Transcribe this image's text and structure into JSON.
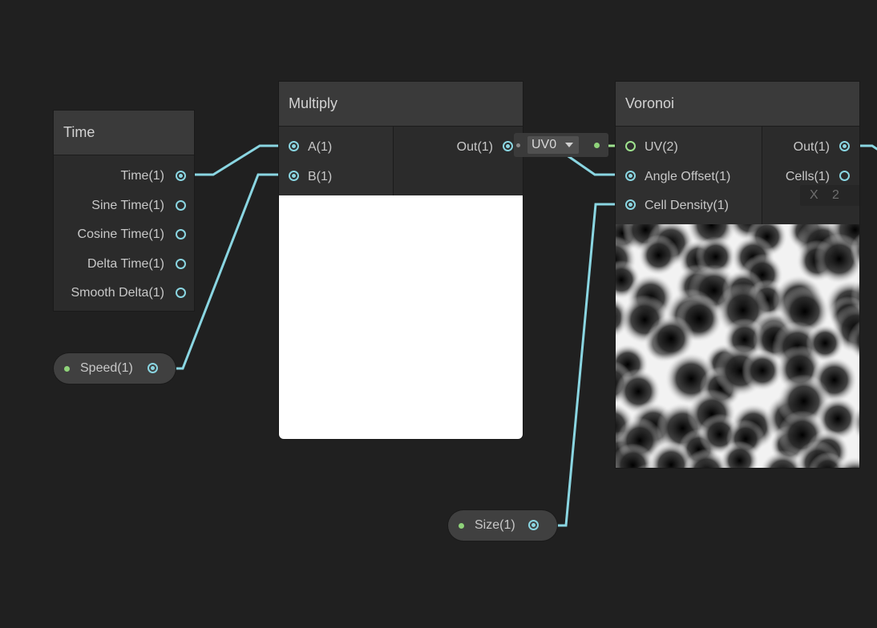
{
  "nodes": {
    "time": {
      "title": "Time",
      "outputs": [
        "Time(1)",
        "Sine Time(1)",
        "Cosine Time(1)",
        "Delta Time(1)",
        "Smooth Delta(1)"
      ]
    },
    "multiply": {
      "title": "Multiply",
      "inputs": [
        "A(1)",
        "B(1)"
      ],
      "outputs": [
        "Out(1)"
      ]
    },
    "voronoi": {
      "title": "Voronoi",
      "inputs": [
        "UV(2)",
        "Angle Offset(1)",
        "Cell Density(1)"
      ],
      "outputs": [
        "Out(1)",
        "Cells(1)"
      ]
    }
  },
  "properties": {
    "speed": "Speed(1)",
    "size": "Size(1)"
  },
  "uv_dropdown": {
    "selected": "UV0"
  },
  "inline_field": {
    "axis": "X",
    "value": "2"
  },
  "colors": {
    "background": "#202020",
    "wire": "#8ad6e2",
    "wire_uv": "#9fe38f",
    "node_body": "#2b2b2b",
    "node_header": "#3a3a3a"
  }
}
